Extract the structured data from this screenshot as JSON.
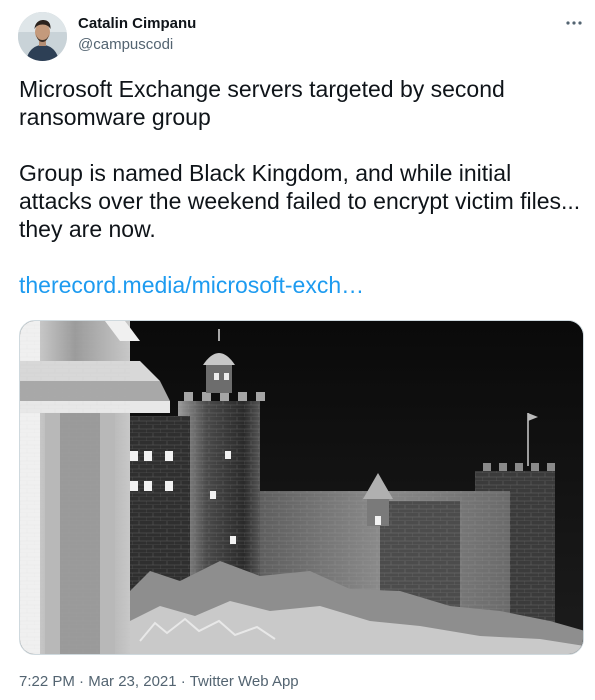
{
  "author": {
    "name": "Catalin Cimpanu",
    "handle": "@campuscodi",
    "avatar_icon": "person-avatar"
  },
  "tweet": {
    "headline": "Microsoft Exchange servers targeted by second ransomware group",
    "body": "Group is named Black Kingdom, and while initial attacks over the weekend failed to encrypt victim files... they are now.",
    "link_text": "therecord.media/microsoft-exch…"
  },
  "meta": {
    "time": "7:22 PM",
    "separator": "·",
    "date": "Mar 23, 2021",
    "source": "Twitter Web App"
  },
  "colors": {
    "link": "#1d9bf0",
    "secondary_text": "#536471",
    "primary_text": "#0f1419"
  },
  "icons": {
    "more": "more-horizontal-icon"
  }
}
